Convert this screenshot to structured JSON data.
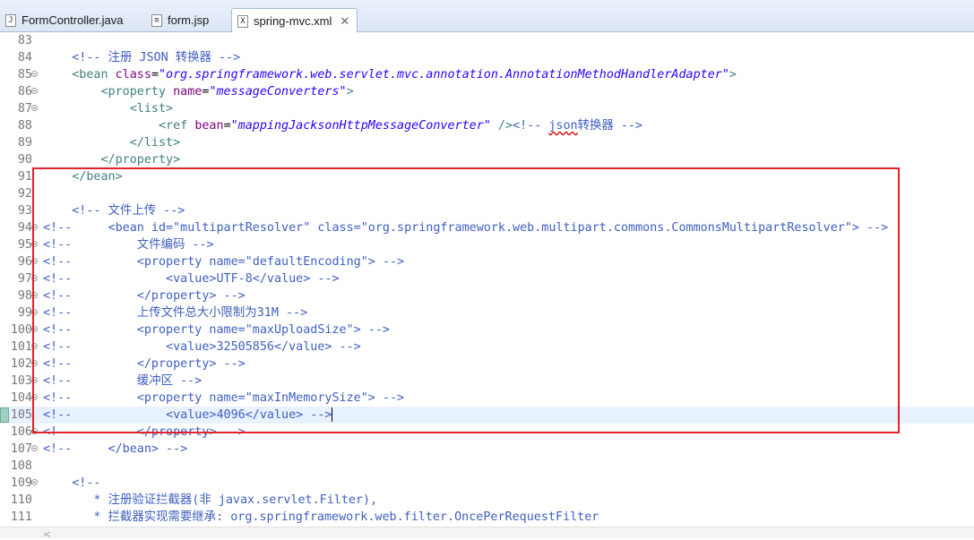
{
  "tabs": [
    {
      "label": "FormController.java",
      "icon": "java-file-icon",
      "active": false
    },
    {
      "label": "form.jsp",
      "icon": "jsp-file-icon",
      "active": false
    },
    {
      "label": "spring-mvc.xml",
      "icon": "xml-file-icon",
      "active": true
    }
  ],
  "editor": {
    "current_line": "105",
    "lines": [
      {
        "num": "83",
        "fold": false,
        "segments": []
      },
      {
        "num": "84",
        "fold": false,
        "segments": [
          {
            "t": "    "
          },
          {
            "c": "comment",
            "t": "<!-- 注册 JSON 转换器 -->"
          }
        ]
      },
      {
        "num": "85",
        "fold": true,
        "segments": [
          {
            "t": "    "
          },
          {
            "c": "tag",
            "t": "<bean "
          },
          {
            "c": "attr",
            "t": "class"
          },
          {
            "c": "text",
            "t": "="
          },
          {
            "c": "val",
            "t": "\"org.springframework.web.servlet.mvc.annotation.AnnotationMethodHandlerAdapter\""
          },
          {
            "c": "tag",
            "t": ">"
          }
        ]
      },
      {
        "num": "86",
        "fold": true,
        "segments": [
          {
            "t": "        "
          },
          {
            "c": "tag",
            "t": "<property "
          },
          {
            "c": "attr",
            "t": "name"
          },
          {
            "c": "text",
            "t": "="
          },
          {
            "c": "val",
            "t": "\"messageConverters\""
          },
          {
            "c": "tag",
            "t": ">"
          }
        ]
      },
      {
        "num": "87",
        "fold": true,
        "segments": [
          {
            "t": "            "
          },
          {
            "c": "tag",
            "t": "<list>"
          }
        ]
      },
      {
        "num": "88",
        "fold": false,
        "segments": [
          {
            "t": "                "
          },
          {
            "c": "tag",
            "t": "<ref "
          },
          {
            "c": "attr",
            "t": "bean"
          },
          {
            "c": "text",
            "t": "="
          },
          {
            "c": "val",
            "t": "\"mappingJacksonHttpMessageConverter\""
          },
          {
            "c": "tag",
            "t": " />"
          },
          {
            "c": "comment",
            "t": "<!-- "
          },
          {
            "c": "comment squiggle",
            "t": "json"
          },
          {
            "c": "comment",
            "t": "转换器 -->"
          }
        ]
      },
      {
        "num": "89",
        "fold": false,
        "segments": [
          {
            "t": "            "
          },
          {
            "c": "tag",
            "t": "</list>"
          }
        ]
      },
      {
        "num": "90",
        "fold": false,
        "segments": [
          {
            "t": "        "
          },
          {
            "c": "tag",
            "t": "</property>"
          }
        ]
      },
      {
        "num": "91",
        "fold": false,
        "segments": [
          {
            "t": "    "
          },
          {
            "c": "tag",
            "t": "</bean>"
          }
        ]
      },
      {
        "num": "92",
        "fold": false,
        "segments": []
      },
      {
        "num": "93",
        "fold": false,
        "segments": [
          {
            "t": "    "
          },
          {
            "c": "comment",
            "t": "<!-- 文件上传 -->"
          }
        ]
      },
      {
        "num": "94",
        "fold": true,
        "segments": [
          {
            "c": "comment",
            "t": "<!--     <bean id=\"multipartResolver\" class=\"org.springframework.web.multipart.commons.CommonsMultipartResolver\"> -->"
          }
        ]
      },
      {
        "num": "95",
        "fold": true,
        "segments": [
          {
            "c": "comment",
            "t": "<!--         文件编码 -->"
          }
        ]
      },
      {
        "num": "96",
        "fold": true,
        "segments": [
          {
            "c": "comment",
            "t": "<!--         <property name=\"defaultEncoding\"> -->"
          }
        ]
      },
      {
        "num": "97",
        "fold": true,
        "segments": [
          {
            "c": "comment",
            "t": "<!--             <value>UTF-8</value> -->"
          }
        ]
      },
      {
        "num": "98",
        "fold": true,
        "segments": [
          {
            "c": "comment",
            "t": "<!--         </property> -->"
          }
        ]
      },
      {
        "num": "99",
        "fold": true,
        "segments": [
          {
            "c": "comment",
            "t": "<!--         上传文件总大小限制为31M -->"
          }
        ]
      },
      {
        "num": "100",
        "fold": true,
        "segments": [
          {
            "c": "comment",
            "t": "<!--         <property name=\"maxUploadSize\"> -->"
          }
        ]
      },
      {
        "num": "101",
        "fold": true,
        "segments": [
          {
            "c": "comment",
            "t": "<!--             <value>32505856</value> -->"
          }
        ]
      },
      {
        "num": "102",
        "fold": true,
        "segments": [
          {
            "c": "comment",
            "t": "<!--         </property> -->"
          }
        ]
      },
      {
        "num": "103",
        "fold": true,
        "segments": [
          {
            "c": "comment",
            "t": "<!--         缓冲区 -->"
          }
        ]
      },
      {
        "num": "104",
        "fold": true,
        "segments": [
          {
            "c": "comment",
            "t": "<!--         <property name=\"maxInMemorySize\"> -->"
          }
        ]
      },
      {
        "num": "105",
        "fold": false,
        "segments": [
          {
            "c": "comment",
            "t": "<!--             <value>4096</value> -->"
          }
        ]
      },
      {
        "num": "106",
        "fold": true,
        "segments": [
          {
            "c": "comment",
            "t": "<!--         </property> -->"
          }
        ]
      },
      {
        "num": "107",
        "fold": true,
        "segments": [
          {
            "c": "comment",
            "t": "<!--     </bean> -->"
          }
        ]
      },
      {
        "num": "108",
        "fold": false,
        "segments": []
      },
      {
        "num": "109",
        "fold": true,
        "segments": [
          {
            "t": "    "
          },
          {
            "c": "comment",
            "t": "<!--"
          }
        ]
      },
      {
        "num": "110",
        "fold": false,
        "segments": [
          {
            "c": "comment",
            "t": "       * 注册验证拦截器(非 javax.servlet.Filter),"
          }
        ]
      },
      {
        "num": "111",
        "fold": false,
        "segments": [
          {
            "c": "comment",
            "t": "       * 拦截器实现需要继承: org.springframework.web.filter.OncePerRequestFilter"
          }
        ]
      }
    ]
  },
  "scrollbar": {
    "left_arrow": "<"
  }
}
